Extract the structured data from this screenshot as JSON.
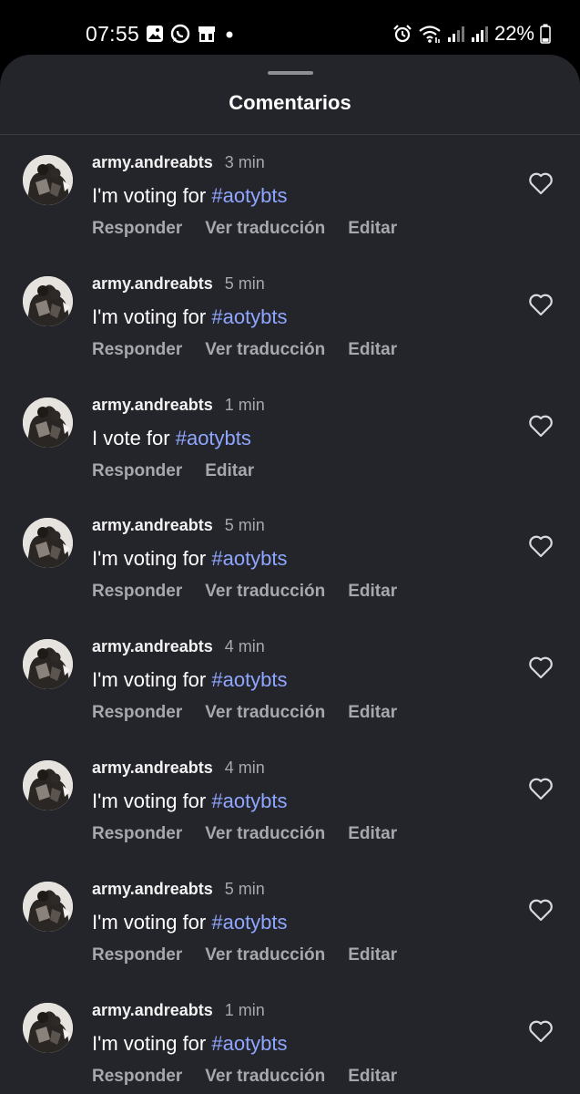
{
  "status_bar": {
    "time": "07:55",
    "left_icons": [
      "gallery-icon",
      "whatsapp-icon",
      "cast-icon",
      "notification-dot-icon"
    ],
    "right_icons": [
      "alarm-icon",
      "wifi-icon",
      "signal-icon",
      "signal-icon",
      "battery-icon"
    ],
    "battery": "22%"
  },
  "sheet": {
    "title": "Comentarios"
  },
  "colors": {
    "background": "#24252a",
    "hashtag": "#8fa6ff",
    "muted": "#a7a8ad"
  },
  "comments": [
    {
      "username": "army.andreabts",
      "time": "3 min",
      "text_prefix": "I'm voting for ",
      "hashtag": "#aotybts",
      "actions": [
        "Responder",
        "Ver traducción",
        "Editar"
      ]
    },
    {
      "username": "army.andreabts",
      "time": "5 min",
      "text_prefix": "I'm voting for ",
      "hashtag": "#aotybts",
      "actions": [
        "Responder",
        "Ver traducción",
        "Editar"
      ]
    },
    {
      "username": "army.andreabts",
      "time": "1 min",
      "text_prefix": "I vote for ",
      "hashtag": "#aotybts",
      "actions": [
        "Responder",
        "Editar"
      ]
    },
    {
      "username": "army.andreabts",
      "time": "5 min",
      "text_prefix": "I'm voting for ",
      "hashtag": "#aotybts",
      "actions": [
        "Responder",
        "Ver traducción",
        "Editar"
      ]
    },
    {
      "username": "army.andreabts",
      "time": "4 min",
      "text_prefix": "I'm voting for ",
      "hashtag": "#aotybts",
      "actions": [
        "Responder",
        "Ver traducción",
        "Editar"
      ]
    },
    {
      "username": "army.andreabts",
      "time": "4 min",
      "text_prefix": "I'm voting for ",
      "hashtag": "#aotybts",
      "actions": [
        "Responder",
        "Ver traducción",
        "Editar"
      ]
    },
    {
      "username": "army.andreabts",
      "time": "5 min",
      "text_prefix": "I'm voting for ",
      "hashtag": "#aotybts",
      "actions": [
        "Responder",
        "Ver traducción",
        "Editar"
      ]
    },
    {
      "username": "army.andreabts",
      "time": "1 min",
      "text_prefix": "I'm voting for ",
      "hashtag": "#aotybts",
      "actions": [
        "Responder",
        "Ver traducción",
        "Editar"
      ]
    }
  ]
}
